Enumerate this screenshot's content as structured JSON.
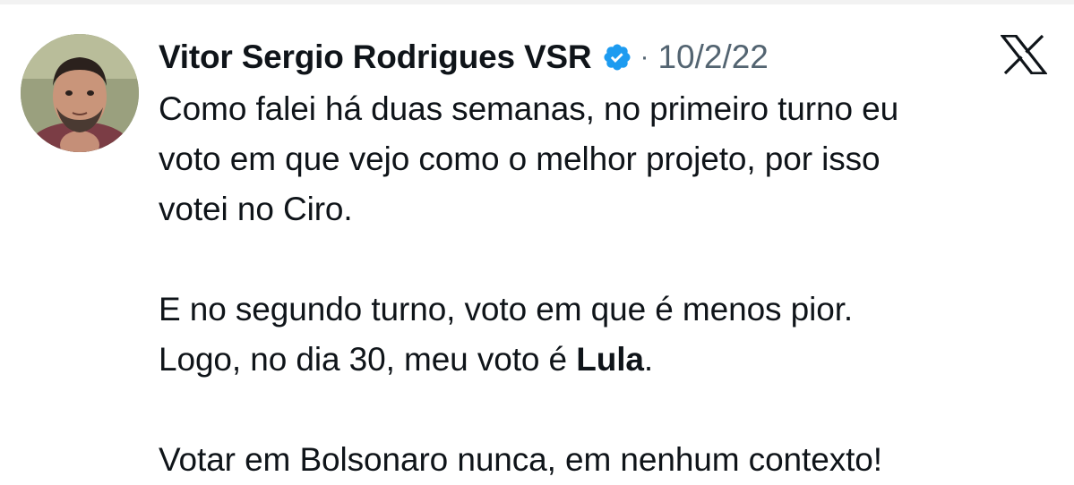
{
  "author": {
    "name": "Vitor Sergio Rodrigues VSR",
    "verified_icon": "verified-badge-icon"
  },
  "separator": "·",
  "date": "10/2/22",
  "platform_icon": "x-logo-icon",
  "body": {
    "p1_line1": "Como falei há duas semanas, no primeiro turno eu",
    "p1_line2": "voto em que vejo como o melhor projeto, por isso",
    "p1_line3": "votei no Ciro.",
    "p2_line1": "E no segundo turno, voto em que é menos pior.",
    "p2_line2_prefix": "Logo, no dia 30, meu voto é ",
    "p2_line2_bold": "Lula",
    "p2_line2_suffix": ".",
    "p3_line1": "Votar em Bolsonaro nunca, em nenhum contexto!"
  },
  "colors": {
    "text": "#0f1419",
    "muted": "#536471",
    "verified": "#1d9bf0"
  }
}
